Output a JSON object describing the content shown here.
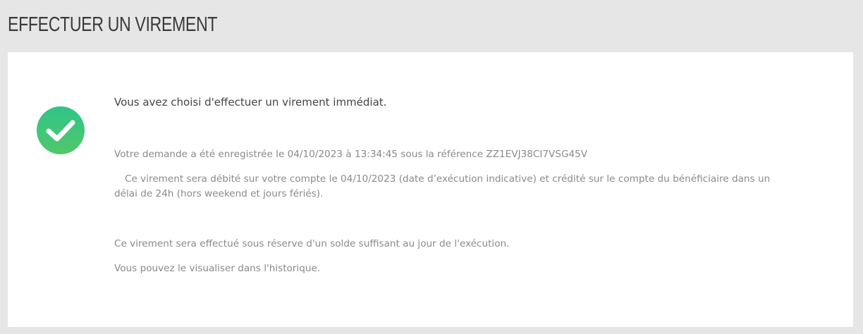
{
  "page": {
    "title": "EFFECTUER UN VIREMENT"
  },
  "status": {
    "icon": "check-circle-icon",
    "color": "#3dc57b"
  },
  "message": {
    "headline": "Vous avez choisi d'effectuer un virement immédiat.",
    "confirmation": "Votre demande a été enregistrée le 04/10/2023 à 13:34:45 sous la référence ZZ1EVJ38CI7VSG45V",
    "debit_info": "Ce virement sera débité sur votre compte le 04/10/2023 (date d’exécution indicative) et crédité sur le compte du bénéficiaire dans un délai de 24h (hors weekend et jours fériés).",
    "reserve_note": "Ce virement sera effectué sous réserve d'un solde suffisant au jour de l'exécution.",
    "history_note": "Vous pouvez le visualiser dans l'historique."
  }
}
